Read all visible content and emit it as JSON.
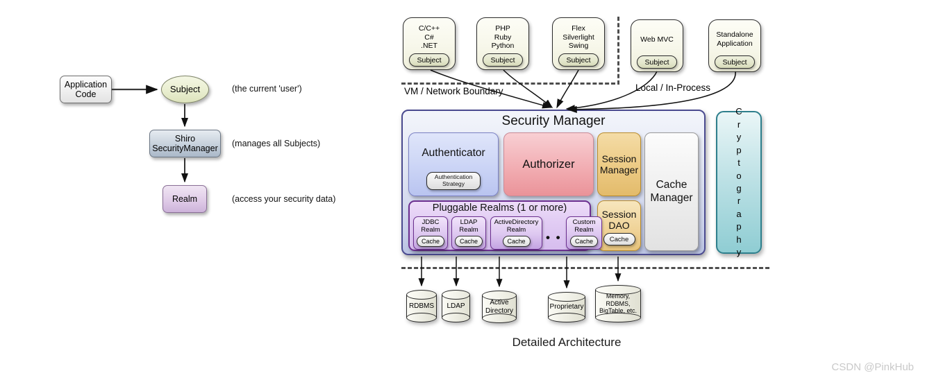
{
  "caption": "Detailed Architecture",
  "watermark": "CSDN @PinkHub",
  "colors": {
    "security_manager_border": "#4a4a8f",
    "authenticator": "#cdd6f6",
    "authorizer": "#f2aeb3",
    "session": "#ecca84",
    "cache_manager": "#f0f0f0",
    "realms": "#d6bdee",
    "cryptography": "#bfe2e6",
    "subject": "#e3e6cb"
  },
  "simple_architecture": {
    "application_code": "Application\nCode",
    "subject": "Subject",
    "security_manager": "Shiro\nSecurityManager",
    "realm": "Realm",
    "notes": [
      "(the current 'user')",
      "(manages all Subjects)",
      "(access your security data)"
    ]
  },
  "clients": [
    {
      "name": "native-client",
      "lines": "C/C++\nC#\n.NET",
      "subject": "Subject"
    },
    {
      "name": "scripting-client",
      "lines": "PHP\nRuby\nPython",
      "subject": "Subject"
    },
    {
      "name": "rich-client",
      "lines": "Flex\nSilverlight\nSwing",
      "subject": "Subject"
    },
    {
      "name": "web-mvc-client",
      "lines": "Web MVC",
      "subject": "Subject"
    },
    {
      "name": "standalone-client",
      "lines": "Standalone\nApplication",
      "subject": "Subject"
    }
  ],
  "boundaries": {
    "remote": "VM / Network Boundary",
    "local": "Local / In-Process"
  },
  "security_manager": {
    "title": "Security Manager",
    "authenticator": {
      "label": "Authenticator",
      "strategy": "Authentication\nStrategy"
    },
    "authorizer": {
      "label": "Authorizer"
    },
    "session_manager": {
      "label": "Session\nManager"
    },
    "session_dao": {
      "label": "Session\nDAO",
      "cache": "Cache"
    },
    "cache_manager": {
      "label": "Cache\nManager"
    },
    "realms": {
      "title": "Pluggable Realms (1 or more)",
      "dots": "• • •",
      "items": [
        {
          "label": "JDBC\nRealm",
          "cache": "Cache"
        },
        {
          "label": "LDAP\nRealm",
          "cache": "Cache"
        },
        {
          "label": "ActiveDirectory\nRealm",
          "cache": "Cache"
        },
        {
          "label": "Custom\nRealm",
          "cache": "Cache"
        }
      ]
    }
  },
  "cryptography": {
    "label": "Cryptography",
    "letters": [
      "C",
      "r",
      "y",
      "p",
      "t",
      "o",
      "g",
      "r",
      "a",
      "p",
      "h",
      "y"
    ]
  },
  "datastores": [
    {
      "label": "RDBMS"
    },
    {
      "label": "LDAP"
    },
    {
      "label": "Active\nDirectory"
    },
    {
      "label": "Proprietary"
    },
    {
      "label": "Memory,\nRDBMS,\nBigTable, etc."
    }
  ]
}
